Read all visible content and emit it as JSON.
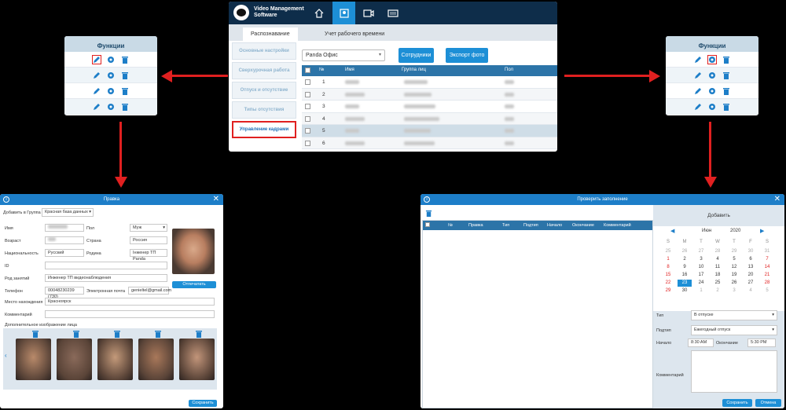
{
  "main_app": {
    "logo_line1": "Video Management",
    "logo_line2": "Software",
    "nav_icons": [
      "home-icon",
      "face-recognition-icon",
      "camera-icon",
      "keyboard-icon"
    ],
    "tabs": [
      "Распознавание",
      "Учет рабочего времени"
    ],
    "side_menu": [
      "Основные настройки",
      "Сверхурочная работа",
      "Отпуск и отсутствие",
      "Типы отсутствия",
      "Управление кадрами"
    ],
    "group_select": "Panda Офис",
    "employees_button": "Сотрудники",
    "export_button": "Экспорт фото",
    "columns": [
      "№",
      "Имя",
      "Группа лиц",
      "Пол"
    ],
    "rows": [
      "1",
      "2",
      "3",
      "4",
      "5",
      "6"
    ]
  },
  "func_left": {
    "title": "Функции"
  },
  "func_right": {
    "title": "Функции"
  },
  "edit_dialog": {
    "title": "Правка",
    "add_to_group_label": "Добавить в Группа",
    "group_value": "Красная база данных",
    "name_label": "Имя",
    "gender_label": "Пол",
    "gender_value": "Муж",
    "age_label": "Возраст",
    "country_label": "Страна",
    "country_value": "Россия",
    "nationality_label": "Национальность",
    "nationality_value": "Русский",
    "homeland_label": "Родина",
    "homeland_value": "Інженер ТП Panda",
    "id_label": "ID",
    "occupation_label": "Род занятий",
    "occupation_value": "Инженер ТП видеонаблюдения",
    "phone_label": "Телефон",
    "phone_value": "00048230239 (730)",
    "email_label": "Электронная почта",
    "email_value": "genieltel@gmail.com",
    "location_label": "Место нахождения",
    "location_value": "Красноярск",
    "comment_label": "Комментарий",
    "extra_images_label": "Дополнительное изображение лица",
    "photo_button": "Отпечатать",
    "save_button": "Сохранить"
  },
  "check_dialog": {
    "title": "Проверить заполнение",
    "columns": [
      "№",
      "Правка",
      "Тип",
      "Подтип",
      "Начало",
      "Окончание",
      "Комментарий"
    ],
    "add_label": "Добавить",
    "month": "Июн",
    "year": "2020",
    "weekdays": [
      "S",
      "M",
      "T",
      "W",
      "T",
      "F",
      "S"
    ],
    "weeks": [
      [
        "25",
        "26",
        "27",
        "28",
        "29",
        "30",
        "31"
      ],
      [
        "1",
        "2",
        "3",
        "4",
        "5",
        "6",
        "7"
      ],
      [
        "8",
        "9",
        "10",
        "11",
        "12",
        "13",
        "14"
      ],
      [
        "15",
        "16",
        "17",
        "18",
        "19",
        "20",
        "21"
      ],
      [
        "22",
        "23",
        "24",
        "25",
        "26",
        "27",
        "28"
      ],
      [
        "29",
        "30",
        "1",
        "2",
        "3",
        "4",
        "5"
      ]
    ],
    "type_label": "Тип",
    "type_value": "В отпуске",
    "subtype_label": "Подтип",
    "subtype_value": "Ежегодный отпуск",
    "start_label": "Начало",
    "start_value": "8:30 AM",
    "end_label": "Окончание",
    "end_value": "5:30 PM",
    "comment_label": "Комментарий",
    "save_button": "Сохранить",
    "cancel_button": "Отмена"
  },
  "colors": {
    "accent": "#1d8fd6",
    "header": "#0e2d4a",
    "highlight": "#e02020"
  }
}
